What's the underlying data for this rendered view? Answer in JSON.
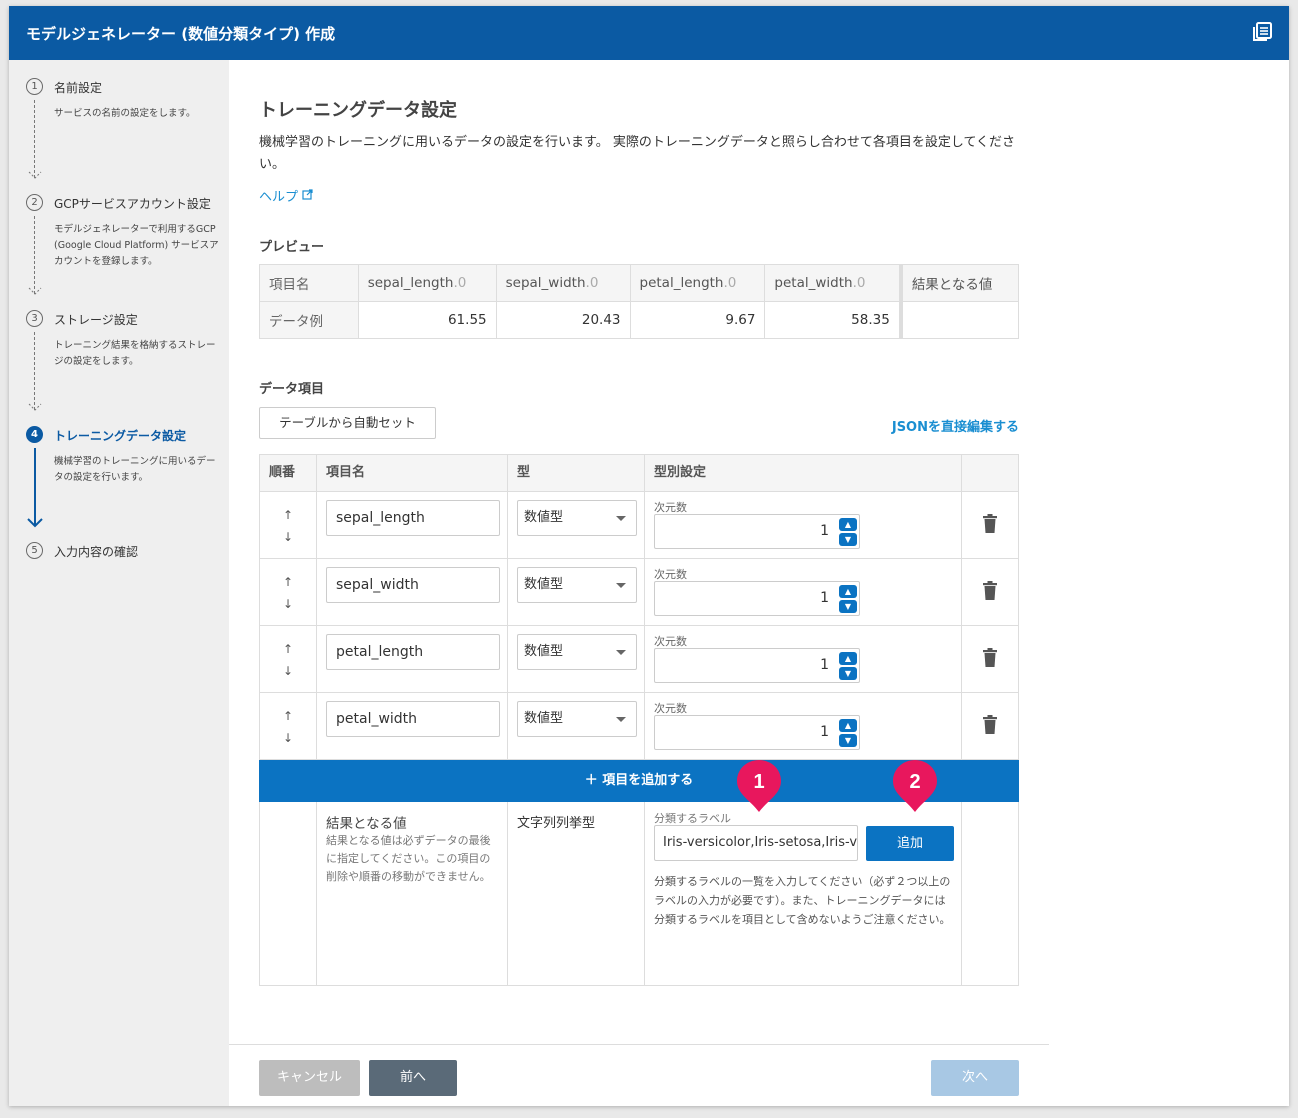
{
  "window": {
    "title": "モデルジェネレーター (数値分類タイプ) 作成",
    "docs_icon": "docs-icon"
  },
  "sidebar": {
    "steps": [
      {
        "num": "1",
        "name": "名前設定",
        "desc": "サービスの名前の設定をします。"
      },
      {
        "num": "2",
        "name": "GCPサービスアカウント設定",
        "desc": "モデルジェネレーターで利用するGCP (Google Cloud Platform) サービスアカウントを登録します。"
      },
      {
        "num": "3",
        "name": "ストレージ設定",
        "desc": "トレーニング結果を格納するストレージの設定をします。"
      },
      {
        "num": "4",
        "name": "トレーニングデータ設定",
        "desc": "機械学習のトレーニングに用いるデータの設定を行います。"
      },
      {
        "num": "5",
        "name": "入力内容の確認",
        "desc": ""
      }
    ],
    "active_step": 4
  },
  "main": {
    "title": "トレーニングデータ設定",
    "intro": "機械学習のトレーニングに用いるデータの設定を行います。 実際のトレーニングデータと照らし合わせて各項目を設定してください。",
    "help_label": "ヘルプ",
    "preview": {
      "heading": "プレビュー",
      "row_labels": [
        "項目名",
        "データ例"
      ],
      "columns": [
        {
          "name": "sepal_length",
          "suffix": ".0",
          "example": "61.55"
        },
        {
          "name": "sepal_width",
          "suffix": ".0",
          "example": "20.43"
        },
        {
          "name": "petal_length",
          "suffix": ".0",
          "example": "9.67"
        },
        {
          "name": "petal_width",
          "suffix": ".0",
          "example": "58.35"
        }
      ],
      "result_label": "結果となる値"
    },
    "data_items": {
      "heading": "データ項目",
      "auto_set_label": "テーブルから自動セット",
      "json_edit_label": "JSONを直接編集する",
      "headers": [
        "順番",
        "項目名",
        "型",
        "型別設定"
      ],
      "rows": [
        {
          "name": "sepal_length",
          "type": "数値型",
          "dim_label": "次元数",
          "dim": "1"
        },
        {
          "name": "sepal_width",
          "type": "数値型",
          "dim_label": "次元数",
          "dim": "1"
        },
        {
          "name": "petal_length",
          "type": "数値型",
          "dim_label": "次元数",
          "dim": "1"
        },
        {
          "name": "petal_width",
          "type": "数値型",
          "dim_label": "次元数",
          "dim": "1"
        }
      ],
      "up_arrow": "↑",
      "down_arrow": "↓",
      "add_item_label": "＋ 項目を追加する",
      "result": {
        "name": "結果となる値",
        "desc": "結果となる値は必ずデータの最後に指定してください。この項目の削除や順番の移動ができません。",
        "type": "文字列列挙型",
        "label_caption": "分類するラベル",
        "label_value": "Iris-versicolor,Iris-setosa,Iris-virginica",
        "add_label": "追加",
        "help": "分類するラベルの一覧を入力してください（必ず２つ以上のラベルの入力が必要です）。また、トレーニングデータには分類するラベルを項目として含めないようご注意ください。"
      }
    },
    "badges": [
      "1",
      "2"
    ],
    "badge_color": "#e8175d"
  },
  "footer": {
    "cancel": "キャンセル",
    "prev": "前へ",
    "next": "次へ"
  },
  "colors": {
    "header": "#0b5aa3",
    "primary": "#0b73c2",
    "link": "#1a8ed1"
  }
}
